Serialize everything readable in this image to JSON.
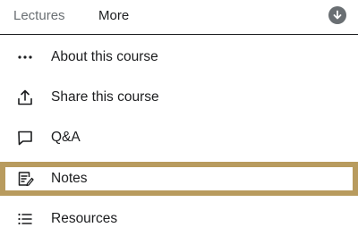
{
  "tabs": [
    {
      "label": "Lectures"
    },
    {
      "label": "More"
    }
  ],
  "menu": {
    "items": [
      {
        "label": "About this course",
        "icon": "more-dots-icon"
      },
      {
        "label": "Share this course",
        "icon": "share-icon"
      },
      {
        "label": "Q&A",
        "icon": "comment-icon"
      },
      {
        "label": "Notes",
        "icon": "notes-icon"
      },
      {
        "label": "Resources",
        "icon": "list-icon"
      }
    ]
  },
  "colors": {
    "text": "#1c1d1f",
    "muted": "#6a6f73",
    "highlight_border": "#b89b5e"
  }
}
